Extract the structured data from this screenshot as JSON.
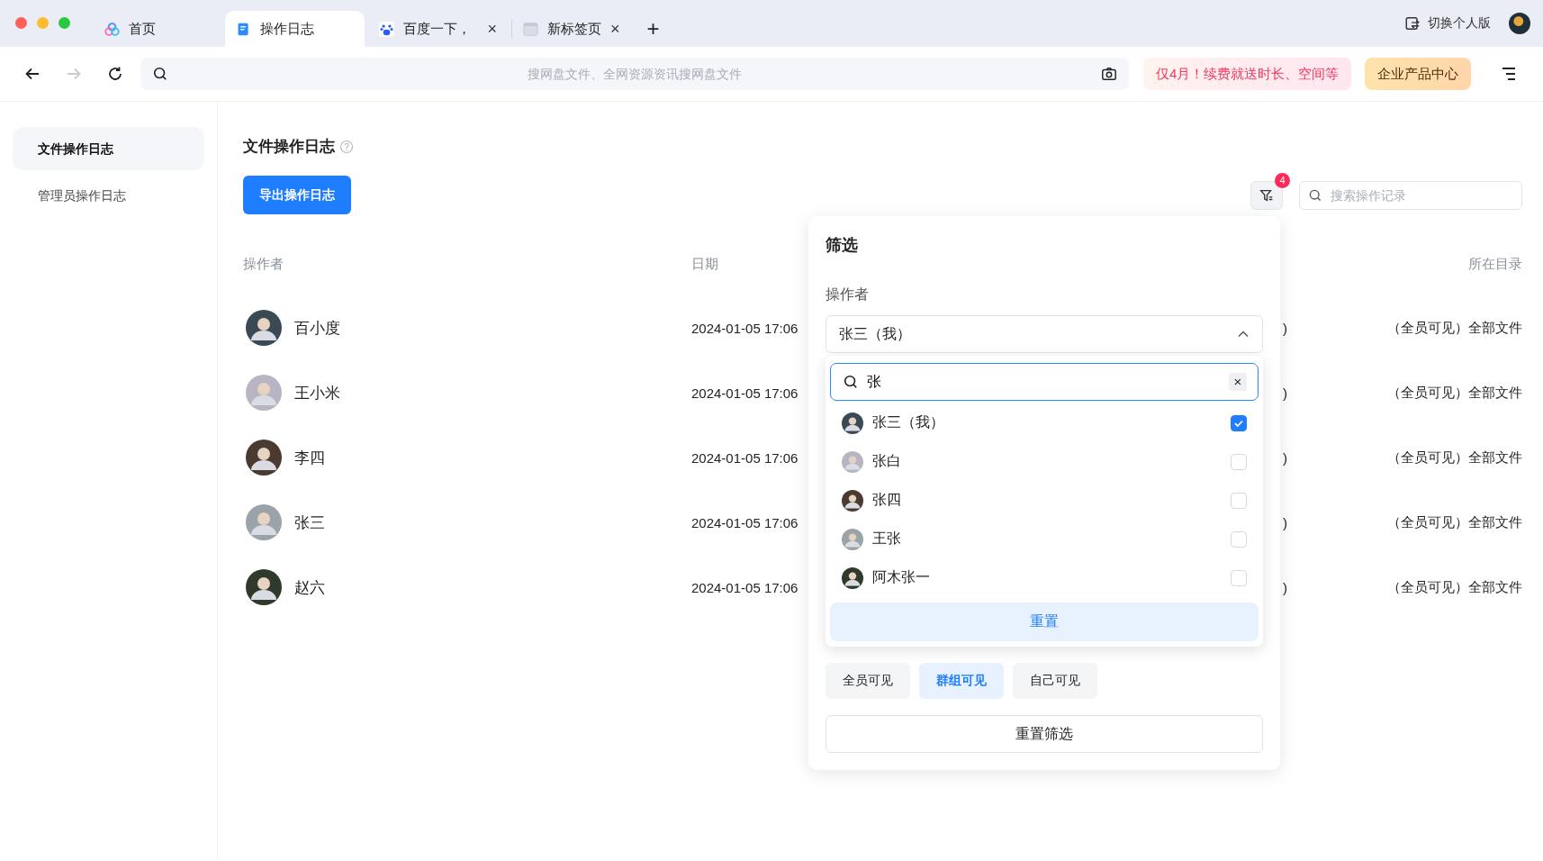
{
  "browser": {
    "tabs": [
      {
        "label": "首页",
        "selected": false,
        "closable": false,
        "kind": "cloud"
      },
      {
        "label": "操作日志",
        "selected": true,
        "closable": false,
        "kind": "doc"
      },
      {
        "label": "百度一下，",
        "selected": false,
        "closable": true,
        "kind": "paw"
      },
      {
        "label": "新标签页",
        "selected": false,
        "closable": true,
        "kind": "blank"
      }
    ],
    "new_tab": "+",
    "close_glyph": "×",
    "switch_label": "切换个人版",
    "address": {
      "placeholder": "搜网盘文件、全网资源资讯搜网盘文件"
    },
    "promo": "仅4月！续费就送时长、空间等",
    "enterprise": "企业产品中心"
  },
  "sidebar": {
    "items": [
      {
        "label": "文件操作日志",
        "selected": true
      },
      {
        "label": "管理员操作日志",
        "selected": false
      }
    ]
  },
  "page": {
    "title": "文件操作日志",
    "export_button": "导出操作日志",
    "filter_badge": "4",
    "search": {
      "placeholder": "搜索操作记录"
    }
  },
  "table": {
    "columns": [
      "操作者",
      "日期",
      "所在目录"
    ],
    "rows": [
      {
        "operator": "百小度",
        "date": "2024-01-05 17:06",
        "column_3": ")",
        "directory": "（全员可见）全部文件"
      },
      {
        "operator": "王小米",
        "date": "2024-01-05 17:06",
        "column_3": ")",
        "directory": "（全员可见）全部文件"
      },
      {
        "operator": "李四",
        "date": "2024-01-05 17:06",
        "column_3": ")",
        "directory": "（全员可见）全部文件"
      },
      {
        "operator": "张三",
        "date": "2024-01-05 17:06",
        "column_3": ")",
        "directory": "（全员可见）全部文件"
      },
      {
        "operator": "赵六",
        "date": "2024-01-05 17:06",
        "column_3": ")",
        "directory": "（全员可见）全部文件"
      }
    ]
  },
  "filter": {
    "title": "筛选",
    "operator_label": "操作者",
    "select_value": "张三（我）",
    "expanded": true,
    "search_value": "张",
    "clear_glyph": "×",
    "options": [
      {
        "name": "张三（我）",
        "checked": true
      },
      {
        "name": "张白",
        "checked": false
      },
      {
        "name": "张四",
        "checked": false
      },
      {
        "name": "王张",
        "checked": false
      },
      {
        "name": "阿木张一",
        "checked": false
      }
    ],
    "reset": "重置",
    "visibility": [
      {
        "label": "全员可见",
        "selected": false
      },
      {
        "label": "群组可见",
        "selected": true
      },
      {
        "label": "自己可见",
        "selected": false
      }
    ],
    "reset_all": "重置筛选"
  }
}
